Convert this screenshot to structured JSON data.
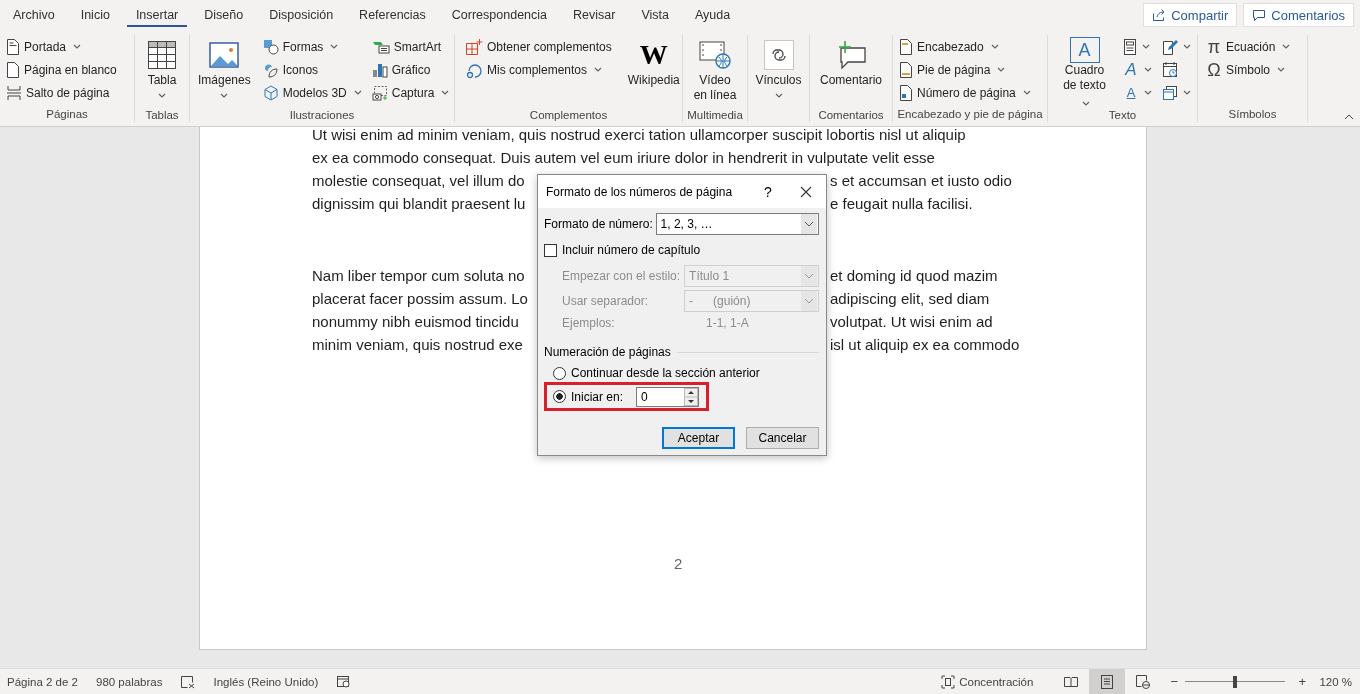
{
  "tabs": [
    {
      "label": "Archivo",
      "selected": false
    },
    {
      "label": "Inicio",
      "selected": false
    },
    {
      "label": "Insertar",
      "selected": true
    },
    {
      "label": "Diseño",
      "selected": false
    },
    {
      "label": "Disposición",
      "selected": false
    },
    {
      "label": "Referencias",
      "selected": false
    },
    {
      "label": "Correspondencia",
      "selected": false
    },
    {
      "label": "Revisar",
      "selected": false
    },
    {
      "label": "Vista",
      "selected": false
    },
    {
      "label": "Ayuda",
      "selected": false
    }
  ],
  "share_button": "Compartir",
  "comments_button": "Comentarios",
  "ribbon": {
    "groups": [
      {
        "label": "Páginas",
        "columns": [
          [
            {
              "kind": "small",
              "label": "Portada",
              "dropdown": true
            },
            {
              "kind": "small",
              "label": "Página en blanco",
              "dropdown": false
            },
            {
              "kind": "small",
              "label": "Salto de página",
              "dropdown": false
            }
          ]
        ]
      },
      {
        "label": "Tablas",
        "columns": [
          [
            {
              "kind": "large",
              "label": "Tabla",
              "dropdown": true
            }
          ]
        ]
      },
      {
        "label": "Ilustraciones",
        "columns": [
          [
            {
              "kind": "large",
              "label": "Imágenes",
              "dropdown": true
            }
          ],
          [
            {
              "kind": "small",
              "label": "Formas",
              "dropdown": true
            },
            {
              "kind": "small",
              "label": "Iconos",
              "dropdown": false
            },
            {
              "kind": "small",
              "label": "Modelos 3D",
              "dropdown": true
            }
          ],
          [
            {
              "kind": "small",
              "label": "SmartArt",
              "dropdown": false
            },
            {
              "kind": "small",
              "label": "Gráfico",
              "dropdown": false
            },
            {
              "kind": "small",
              "label": "Captura",
              "dropdown": true
            }
          ]
        ]
      },
      {
        "label": "Complementos",
        "columns": [
          [
            {
              "kind": "small",
              "label": "Obtener complementos",
              "dropdown": false
            },
            {
              "kind": "small",
              "label": "Mis complementos",
              "dropdown": true
            }
          ],
          [
            {
              "kind": "large",
              "label": "Wikipedia",
              "glyph": "W",
              "dropdown": false
            }
          ]
        ]
      },
      {
        "label": "Multimedia",
        "columns": [
          [
            {
              "kind": "large",
              "label": "Vídeo en línea",
              "dropdown": false
            }
          ]
        ]
      },
      {
        "columns": [
          [
            {
              "kind": "large",
              "label": "Vínculos",
              "dropdown": true
            }
          ]
        ]
      },
      {
        "label": "Comentarios",
        "columns": [
          [
            {
              "kind": "large",
              "label": "Comentario",
              "dropdown": false
            }
          ]
        ]
      },
      {
        "label": "Encabezado y pie de página",
        "columns": [
          [
            {
              "kind": "small",
              "label": "Encabezado",
              "dropdown": true
            },
            {
              "kind": "small",
              "label": "Pie de página",
              "dropdown": true
            },
            {
              "kind": "small",
              "label": "Número de página",
              "dropdown": true
            }
          ]
        ]
      },
      {
        "label": "Texto",
        "columns": [
          [
            {
              "kind": "large",
              "label": "Cuadro de texto",
              "glyph": "A",
              "dropdown": true
            }
          ],
          [
            {
              "kind": "icon",
              "dropdown": true
            },
            {
              "kind": "icon",
              "glyph": "A",
              "dropdown": true
            },
            {
              "kind": "icon",
              "glyph": "A",
              "dropdown": true
            }
          ],
          [
            {
              "kind": "icon",
              "dropdown": true
            },
            {
              "kind": "icon",
              "dropdown": false
            },
            {
              "kind": "icon",
              "dropdown": true
            }
          ]
        ]
      },
      {
        "label": "Símbolos",
        "columns": [
          [
            {
              "kind": "small",
              "label": "Ecuación",
              "glyph": "π",
              "dropdown": true
            },
            {
              "kind": "small",
              "label": "Símbolo",
              "glyph": "Ω",
              "dropdown": true
            }
          ]
        ]
      }
    ]
  },
  "document": {
    "paragraphs": [
      [
        {
          "text": "Ut wisi enim ad minim veniam, quis nostrud exerci tation ullamcorper suscipit lobortis nisl ut aliquip"
        },
        {
          "text": "ex ea commodo consequat. Duis autem vel eum iriure dolor in hendrerit in vulputate velit esse"
        },
        {
          "left": "molestie consequat, vel illum do",
          "right": "s et accumsan et iusto odio"
        },
        {
          "left": "dignissim qui blandit praesent lu",
          "right": "e feugait nulla facilisi."
        }
      ],
      [
        {
          "left": "Nam liber tempor cum soluta no",
          "right": "et doming id quod mazim"
        },
        {
          "left": "placerat facer possim assum. Lo",
          "right": "adipiscing elit, sed diam"
        },
        {
          "left": "nonummy nibh euismod tincidu",
          "right": "volutpat. Ut wisi enim ad"
        },
        {
          "left": "minim veniam, quis nostrud exe",
          "right": "isl ut aliquip ex ea commodo"
        }
      ]
    ],
    "page_number": "2"
  },
  "dialog": {
    "title": "Formato de los números de página",
    "help": "?",
    "number_format": {
      "label": "Formato de número:",
      "value": "1, 2, 3, …"
    },
    "include_chapter": {
      "label": "Incluir número de capítulo",
      "checked": false
    },
    "chapter_style": {
      "label": "Empezar con el estilo:",
      "value": "Título 1",
      "disabled": true
    },
    "separator": {
      "label": "Usar separador:",
      "value": "-      (guión)",
      "disabled": true
    },
    "examples": {
      "label": "Ejemplos:",
      "value": "1-1, 1-A",
      "disabled": true
    },
    "numbering": {
      "label": "Numeración de páginas",
      "options": [
        {
          "label": "Continuar desde la sección anterior",
          "selected": false,
          "highlighted": false
        },
        {
          "label": "Iniciar en:",
          "selected": true,
          "highlighted": true,
          "value": "0"
        }
      ]
    },
    "buttons": [
      {
        "label": "Aceptar",
        "default": true
      },
      {
        "label": "Cancelar",
        "default": false
      }
    ]
  },
  "status_bar": {
    "page": "Página 2 de 2",
    "words": "980 palabras",
    "language": "Inglés (Reino Unido)",
    "focus": "Concentración",
    "views": [
      {
        "selected": false
      },
      {
        "selected": true
      },
      {
        "selected": false
      }
    ],
    "zoom_out": "−",
    "zoom_in": "+",
    "zoom": {
      "level": 0.5
    },
    "zoom_text": "120 %"
  }
}
